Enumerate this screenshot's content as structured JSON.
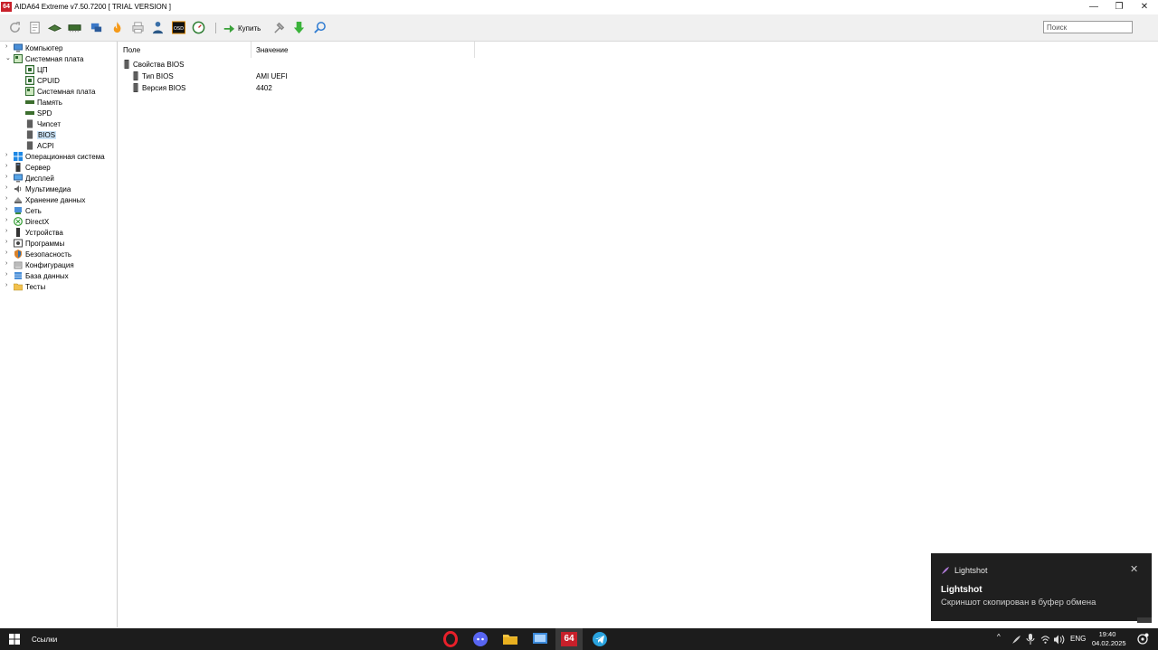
{
  "window": {
    "icon_text": "64",
    "title": "AIDA64 Extreme v7.50.7200  [ TRIAL VERSION ]",
    "minimize": "—",
    "restore": "❐",
    "close": "✕"
  },
  "toolbar": {
    "buy_label": "Купить",
    "search_placeholder": "Поиск"
  },
  "tree": {
    "items": [
      {
        "label": "Компьютер",
        "expanded": false
      },
      {
        "label": "Системная плата",
        "expanded": true
      },
      {
        "label": "ЦП"
      },
      {
        "label": "CPUID"
      },
      {
        "label": "Системная плата"
      },
      {
        "label": "Память"
      },
      {
        "label": "SPD"
      },
      {
        "label": "Чипсет"
      },
      {
        "label": "BIOS",
        "selected": true
      },
      {
        "label": "ACPI"
      },
      {
        "label": "Операционная система",
        "expanded": false
      },
      {
        "label": "Сервер",
        "expanded": false
      },
      {
        "label": "Дисплей",
        "expanded": false
      },
      {
        "label": "Мультимедиа",
        "expanded": false
      },
      {
        "label": "Хранение данных",
        "expanded": false
      },
      {
        "label": "Сеть",
        "expanded": false
      },
      {
        "label": "DirectX",
        "expanded": false
      },
      {
        "label": "Устройства",
        "expanded": false
      },
      {
        "label": "Программы",
        "expanded": false
      },
      {
        "label": "Безопасность",
        "expanded": false
      },
      {
        "label": "Конфигурация",
        "expanded": false
      },
      {
        "label": "База данных",
        "expanded": false
      },
      {
        "label": "Тесты",
        "expanded": false
      }
    ]
  },
  "content": {
    "columns": [
      "Поле",
      "Значение"
    ],
    "group": "Свойства BIOS",
    "rows": [
      {
        "field": "Тип BIOS",
        "value": "AMI UEFI"
      },
      {
        "field": "Версия BIOS",
        "value": "4402"
      }
    ]
  },
  "notification": {
    "app": "Lightshot",
    "title": "Lightshot",
    "message": "Скриншот скопирован в буфер обмена",
    "close": "✕"
  },
  "taskbar": {
    "links_label": "Ссылки",
    "aida_label": "64",
    "tray_up": "^",
    "language": "ENG",
    "time": "19:40",
    "date": "04.02.2025"
  },
  "colors": {
    "accent_red": "#c8202a",
    "selection": "#cce4f7",
    "toast_bg": "#1f1f1f",
    "taskbar_bg": "#1c1c1c"
  }
}
